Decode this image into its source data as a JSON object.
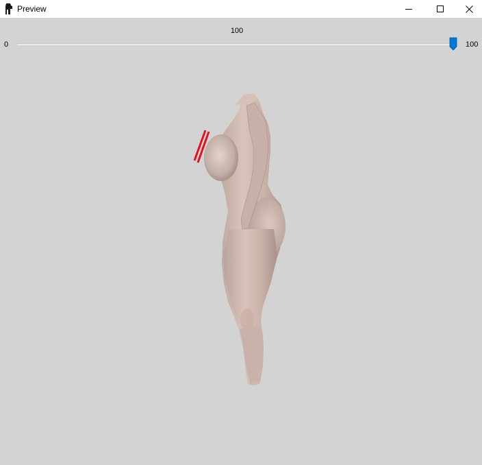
{
  "window": {
    "title": "Preview",
    "controls": [
      "minimize-icon",
      "maximize-icon",
      "close-icon"
    ]
  },
  "slider": {
    "value_label": "100",
    "min_label": "0",
    "max_label": "100",
    "value": 100,
    "min": 0,
    "max": 100,
    "accent_color": "#0078d7"
  },
  "preview": {
    "background_color": "#d3d3d3",
    "marker_color": "#e0141e"
  }
}
